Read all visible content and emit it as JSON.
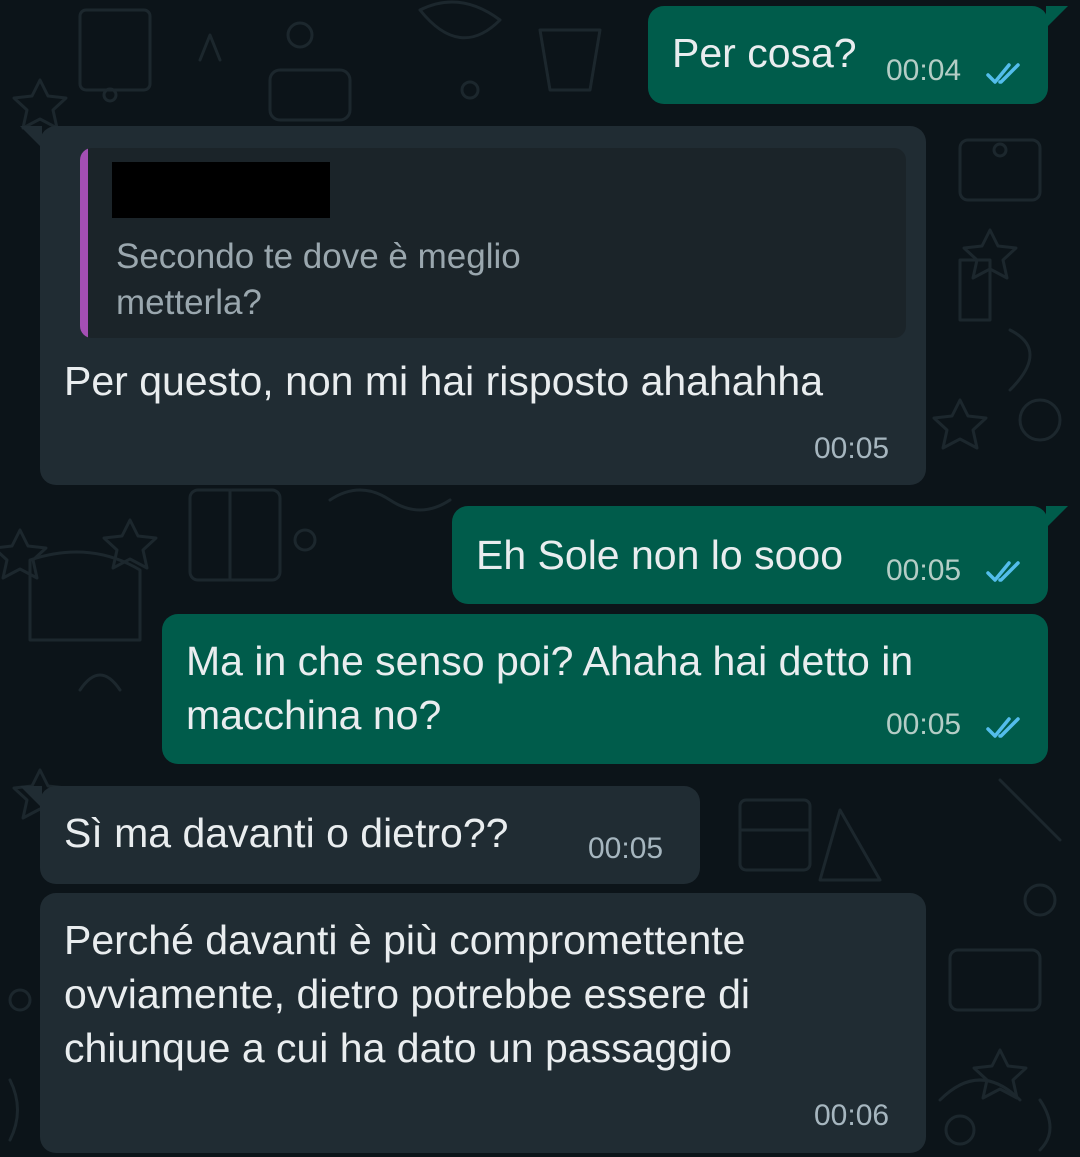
{
  "colors": {
    "chat_background": "#0c1419",
    "outgoing_bubble": "#005c4b",
    "incoming_bubble": "#202c33",
    "read_ticks": "#53bdeb",
    "quote_accent": "#a44fb4"
  },
  "messages": [
    {
      "direction": "outgoing",
      "text": "Per cosa?",
      "time": "00:04",
      "status": "read"
    },
    {
      "direction": "incoming",
      "quote": {
        "author": "[redacted]",
        "text": "Secondo te dove è meglio\nmetterla?"
      },
      "text": "Per questo, non mi hai risposto ahahahha",
      "time": "00:05"
    },
    {
      "direction": "outgoing",
      "text": "Eh Sole non lo sooo",
      "time": "00:05",
      "status": "read"
    },
    {
      "direction": "outgoing",
      "text": "Ma in che senso poi? Ahaha hai detto in\nmacchina no?",
      "time": "00:05",
      "status": "read"
    },
    {
      "direction": "incoming",
      "text": "Sì ma davanti o dietro??",
      "time": "00:05"
    },
    {
      "direction": "incoming",
      "text": "Perché davanti è più compromettente\novviamente, dietro potrebbe essere di\nchiunque a cui ha dato un passaggio",
      "time": "00:06"
    }
  ]
}
